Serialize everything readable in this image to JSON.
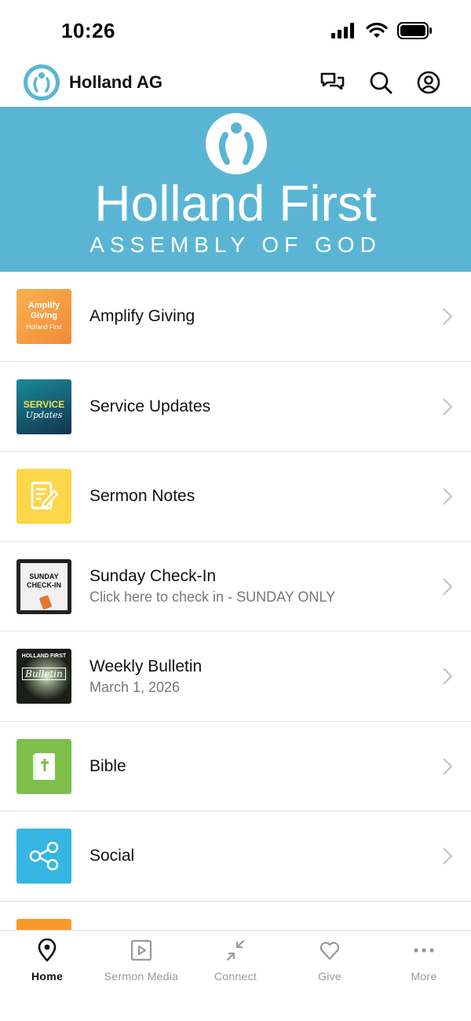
{
  "status_bar": {
    "time": "10:26"
  },
  "header": {
    "title": "Holland AG"
  },
  "banner": {
    "title": "Holland First",
    "subtitle": "ASSEMBLY OF GOD"
  },
  "list": {
    "items": [
      {
        "title": "Amplify Giving",
        "subtitle": "",
        "thumb": {
          "line1": "Amplify",
          "line2": "Giving",
          "line3": "Holland First"
        }
      },
      {
        "title": "Service Updates",
        "subtitle": "",
        "thumb": {
          "line1": "SERVICE",
          "line2": "Updates"
        }
      },
      {
        "title": "Sermon Notes",
        "subtitle": ""
      },
      {
        "title": "Sunday Check-In",
        "subtitle": "Click here to check in - SUNDAY ONLY",
        "thumb": {
          "line1": "SUNDAY",
          "line2": "CHECK-IN"
        }
      },
      {
        "title": "Weekly Bulletin",
        "subtitle": "March 1, 2026",
        "thumb": {
          "line1": "HOLLAND FIRST",
          "line2": "Bulletin"
        }
      },
      {
        "title": "Bible",
        "subtitle": ""
      },
      {
        "title": "Social",
        "subtitle": ""
      }
    ]
  },
  "tab_bar": {
    "tabs": [
      {
        "label": "Home",
        "icon": "location-pin-icon",
        "active": true
      },
      {
        "label": "Sermon Media",
        "icon": "play-square-icon",
        "active": false
      },
      {
        "label": "Connect",
        "icon": "collapse-arrows-icon",
        "active": false
      },
      {
        "label": "Give",
        "icon": "heart-icon",
        "active": false
      },
      {
        "label": "More",
        "icon": "ellipsis-icon",
        "active": false
      }
    ]
  },
  "colors": {
    "brand": "#5ab5d4",
    "tab_inactive": "#999999",
    "tab_active": "#111111"
  }
}
